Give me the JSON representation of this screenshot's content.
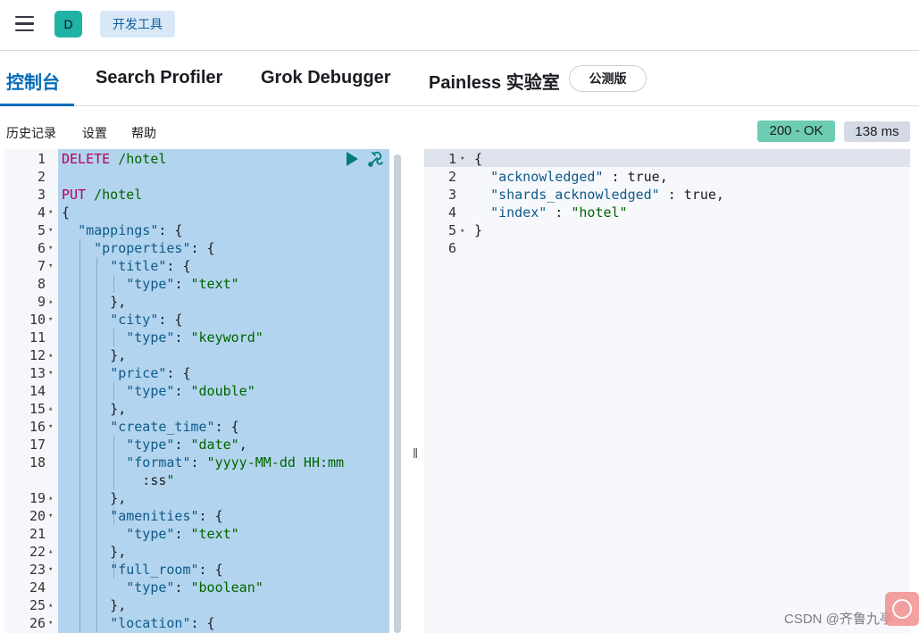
{
  "header": {
    "avatar_letter": "D",
    "breadcrumb": "开发工具"
  },
  "tabs": [
    {
      "label": "控制台"
    },
    {
      "label": "Search Profiler"
    },
    {
      "label": "Grok Debugger"
    },
    {
      "label": "Painless 实验室"
    }
  ],
  "beta_badge": "公测版",
  "toolbar": {
    "history": "历史记录",
    "settings": "设置",
    "help": "帮助"
  },
  "status": {
    "code": "200 - OK",
    "time": "138 ms"
  },
  "editor": {
    "lines": [
      {
        "n": "1",
        "fold": "",
        "text": "DELETE /hotel"
      },
      {
        "n": "2",
        "fold": "",
        "text": ""
      },
      {
        "n": "3",
        "fold": "",
        "text": "PUT /hotel"
      },
      {
        "n": "4",
        "fold": "▾",
        "text": "{"
      },
      {
        "n": "5",
        "fold": "▾",
        "text": "  \"mappings\": {"
      },
      {
        "n": "6",
        "fold": "▾",
        "text": "    \"properties\": {"
      },
      {
        "n": "7",
        "fold": "▾",
        "text": "      \"title\": {"
      },
      {
        "n": "8",
        "fold": "",
        "text": "        \"type\": \"text\""
      },
      {
        "n": "9",
        "fold": "▴",
        "text": "      },"
      },
      {
        "n": "10",
        "fold": "▾",
        "text": "      \"city\": {"
      },
      {
        "n": "11",
        "fold": "",
        "text": "        \"type\": \"keyword\""
      },
      {
        "n": "12",
        "fold": "▴",
        "text": "      },"
      },
      {
        "n": "13",
        "fold": "▾",
        "text": "      \"price\": {"
      },
      {
        "n": "14",
        "fold": "",
        "text": "        \"type\": \"double\""
      },
      {
        "n": "15",
        "fold": "▴",
        "text": "      },"
      },
      {
        "n": "16",
        "fold": "▾",
        "text": "      \"create_time\": {"
      },
      {
        "n": "17",
        "fold": "",
        "text": "        \"type\": \"date\","
      },
      {
        "n": "18",
        "fold": "",
        "text": "        \"format\": \"yyyy-MM-dd HH:mm"
      },
      {
        "n": "",
        "fold": "",
        "text": "          :ss\""
      },
      {
        "n": "19",
        "fold": "▴",
        "text": "      },"
      },
      {
        "n": "20",
        "fold": "▾",
        "text": "      \"amenities\": {"
      },
      {
        "n": "21",
        "fold": "",
        "text": "        \"type\": \"text\""
      },
      {
        "n": "22",
        "fold": "▴",
        "text": "      },"
      },
      {
        "n": "23",
        "fold": "▾",
        "text": "      \"full_room\": {"
      },
      {
        "n": "24",
        "fold": "",
        "text": "        \"type\": \"boolean\""
      },
      {
        "n": "25",
        "fold": "▴",
        "text": "      },"
      },
      {
        "n": "26",
        "fold": "▾",
        "text": "      \"location\": {"
      }
    ]
  },
  "output": {
    "lines": [
      {
        "n": "1",
        "fold": "▾",
        "text": "{"
      },
      {
        "n": "2",
        "fold": "",
        "text": "  \"acknowledged\" : true,"
      },
      {
        "n": "3",
        "fold": "",
        "text": "  \"shards_acknowledged\" : true,"
      },
      {
        "n": "4",
        "fold": "",
        "text": "  \"index\" : \"hotel\""
      },
      {
        "n": "5",
        "fold": "▴",
        "text": "}"
      },
      {
        "n": "6",
        "fold": "",
        "text": ""
      }
    ]
  },
  "watermark": "CSDN @齐鲁九亭",
  "icons": {
    "menu": "hamburger-icon",
    "run": "play-icon",
    "settings": "wrench-icon",
    "resize": "drag-handle-icon",
    "help": "help-icon"
  },
  "colors": {
    "accent": "#006bb8",
    "status_ok": "#6dccb1",
    "selection": "#b3d4ee",
    "method": "#b4005a",
    "string": "#006400"
  }
}
